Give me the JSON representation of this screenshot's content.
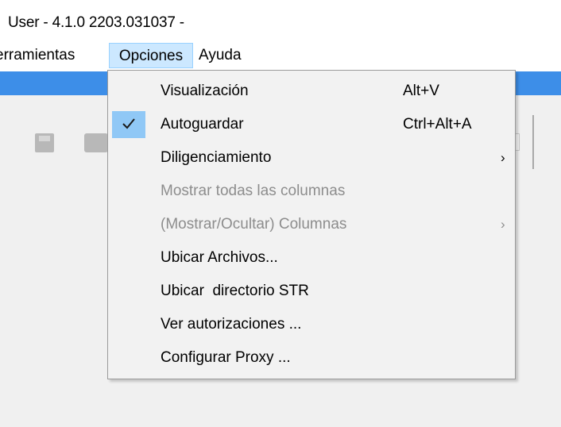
{
  "window": {
    "title": "User - 4.1.0  2203.031037 -"
  },
  "menubar": {
    "herramientas": "erramientas",
    "opciones": "Opciones",
    "ayuda": "Ayuda"
  },
  "toolbar": {
    "icons": [
      "save-icon",
      "print-icon"
    ]
  },
  "dropdown": {
    "items": [
      {
        "label": "Visualización",
        "shortcut": "Alt+V",
        "checked": false,
        "submenu": false,
        "enabled": true
      },
      {
        "label": "Autoguardar",
        "shortcut": "Ctrl+Alt+A",
        "checked": true,
        "submenu": false,
        "enabled": true
      },
      {
        "label": "Diligenciamiento",
        "shortcut": "",
        "checked": false,
        "submenu": true,
        "enabled": true
      },
      {
        "label": "Mostrar todas las columnas",
        "shortcut": "",
        "checked": false,
        "submenu": false,
        "enabled": false
      },
      {
        "label": "(Mostrar/Ocultar) Columnas",
        "shortcut": "",
        "checked": false,
        "submenu": true,
        "enabled": false
      },
      {
        "label": "Ubicar Archivos...",
        "shortcut": "",
        "checked": false,
        "submenu": false,
        "enabled": true
      },
      {
        "label": "Ubicar  directorio STR",
        "shortcut": "",
        "checked": false,
        "submenu": false,
        "enabled": true
      },
      {
        "label": "Ver autorizaciones ...",
        "shortcut": "",
        "checked": false,
        "submenu": false,
        "enabled": true
      },
      {
        "label": "Configurar Proxy ...",
        "shortcut": "",
        "checked": false,
        "submenu": false,
        "enabled": true
      }
    ],
    "submenu_arrow": "›"
  },
  "colors": {
    "title_band": "#3d8ee8",
    "menu_highlight": "#cce8ff",
    "check_highlight": "#90c8f6",
    "disabled_text": "#8d8d8d"
  }
}
